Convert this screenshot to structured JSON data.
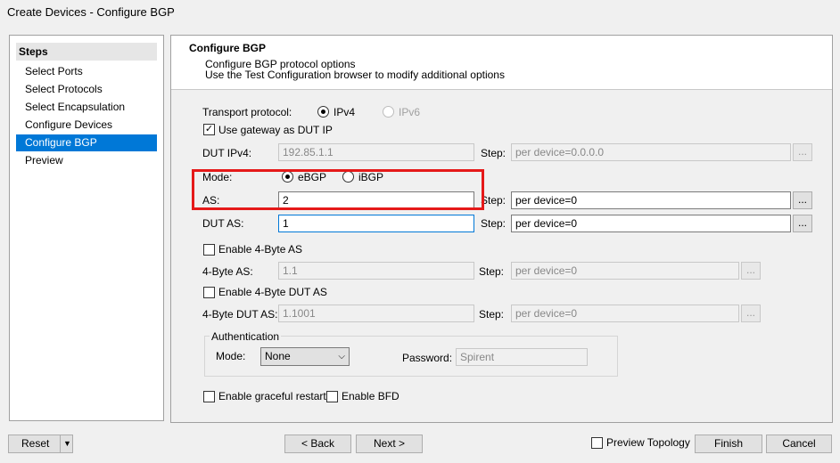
{
  "window": {
    "title": "Create Devices - Configure BGP"
  },
  "steps": {
    "header": "Steps",
    "items": [
      {
        "label": "Select Ports"
      },
      {
        "label": "Select Protocols"
      },
      {
        "label": "Select Encapsulation"
      },
      {
        "label": "Configure Devices"
      },
      {
        "label": "Configure BGP"
      },
      {
        "label": "Preview"
      }
    ],
    "active_index": 4
  },
  "header": {
    "title": "Configure BGP",
    "line1": "Configure BGP protocol options",
    "line2": "Use the Test Configuration browser to modify additional options"
  },
  "form": {
    "transport_label": "Transport protocol:",
    "ipv4_label": "IPv4",
    "ipv6_label": "IPv6",
    "use_gateway_label": "Use gateway as DUT IP",
    "dut_ipv4_label": "DUT IPv4:",
    "dut_ipv4_value": "192.85.1.1",
    "step_label": "Step:",
    "dut_ipv4_step": "per device=0.0.0.0",
    "mode_label": "Mode:",
    "ebgp_label": "eBGP",
    "ibgp_label": "iBGP",
    "as_label": "AS:",
    "as_value": "2",
    "as_step": "per device=0",
    "dut_as_label": "DUT AS:",
    "dut_as_value": "1",
    "dut_as_step": "per device=0",
    "enable_4byte_as_label": "Enable 4-Byte AS",
    "four_byte_as_label": "4-Byte AS:",
    "four_byte_as_value": "1.1",
    "four_byte_as_step": "per device=0",
    "enable_4byte_dut_as_label": "Enable 4-Byte DUT AS",
    "four_byte_dut_as_label": "4-Byte DUT AS:",
    "four_byte_dut_as_value": "1.1001",
    "four_byte_dut_as_step": "per device=0",
    "ellipsis": "...",
    "auth_title": "Authentication",
    "auth_mode_label": "Mode:",
    "auth_mode_value": "None",
    "password_label": "Password:",
    "password_value": "Spirent",
    "graceful_restart_label": "Enable graceful restart",
    "bfd_label": "Enable BFD"
  },
  "footer": {
    "reset_label": "Reset",
    "back_label": "< Back",
    "next_label": "Next >",
    "preview_topology_label": "Preview Topology",
    "finish_label": "Finish",
    "cancel_label": "Cancel"
  },
  "colors": {
    "accent": "#0078d7",
    "highlight": "#e51919"
  }
}
